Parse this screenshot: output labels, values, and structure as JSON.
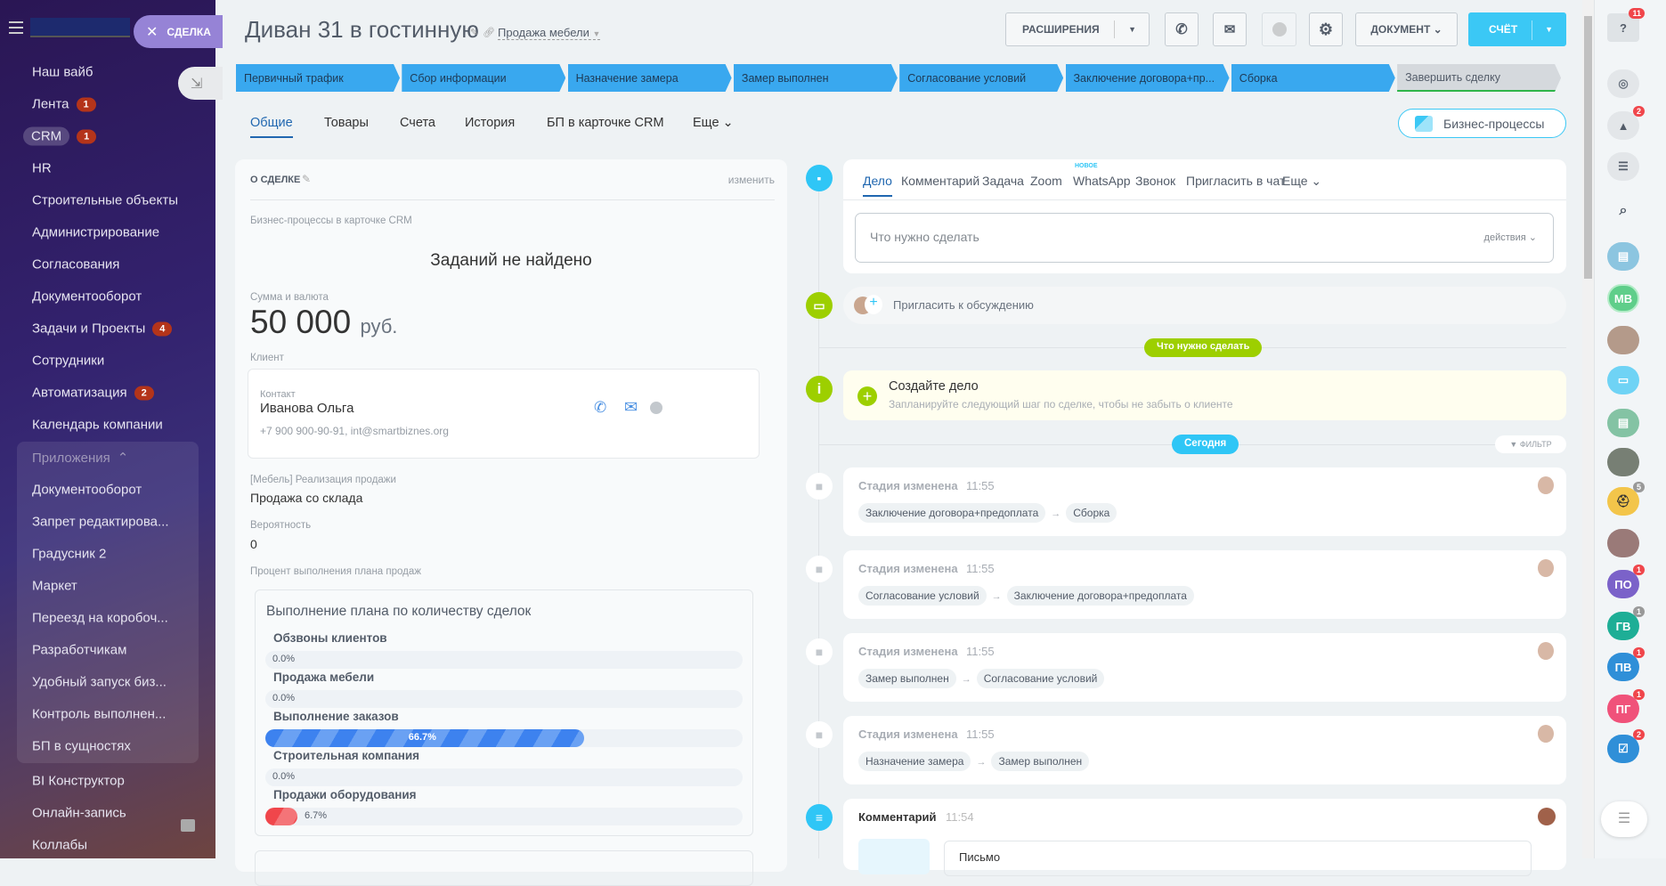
{
  "sidebar": {
    "deal_pill": "СДЕЛКА",
    "items": [
      {
        "label": "Наш вайб"
      },
      {
        "label": "Лента",
        "badge": "1"
      },
      {
        "label": "CRM",
        "badge": "1"
      },
      {
        "label": "HR"
      },
      {
        "label": "Строительные объекты"
      },
      {
        "label": "Администрирование"
      },
      {
        "label": "Согласования"
      },
      {
        "label": "Документооборот"
      },
      {
        "label": "Задачи и Проекты",
        "badge": "4"
      },
      {
        "label": "Сотрудники"
      },
      {
        "label": "Автоматизация",
        "badge": "2"
      },
      {
        "label": "Календарь компании"
      }
    ],
    "apps_header": "Приложения",
    "apps": [
      "Документооборот",
      "Запрет редактирова...",
      "Градусник 2",
      "Маркет",
      "Переезд на коробоч...",
      "Разработчикам",
      "Удобный запуск биз...",
      "Контроль выполнен...",
      "БП в сущностях"
    ],
    "bottom": [
      "BI Конструктор",
      "Онлайн-запись",
      "Коллабы"
    ]
  },
  "header": {
    "title": "Диван 31 в гостинную",
    "pipeline": "Продажа мебели",
    "extensions": "РАСШИРЕНИЯ",
    "document": "ДОКУМЕНТ",
    "invoice": "СЧЁТ"
  },
  "stages": [
    "Первичный трафик",
    "Сбор информации",
    "Назначение замера",
    "Замер выполнен",
    "Согласование условий",
    "Заключение договора+пр...",
    "Сборка",
    "Завершить сделку"
  ],
  "tabs": [
    "Общие",
    "Товары",
    "Счета",
    "История",
    "БП в карточке CRM",
    "Еще"
  ],
  "bp_button": "Бизнес-процессы",
  "deal": {
    "section_title": "О СДЕЛКЕ",
    "edit": "изменить",
    "bp_label": "Бизнес-процессы в карточке CRM",
    "bp_empty": "Заданий не найдено",
    "sum_label": "Сумма и валюта",
    "sum": "50 000",
    "currency": "руб.",
    "client_label": "Клиент",
    "contact_label": "Контакт",
    "contact_name": "Иванова Ольга",
    "contact_info": "+7 900 900-90-91, int@smartbiznes.org",
    "field1_label": "[Мебель] Реализация продажи",
    "field1_value": "Продажа со склада",
    "prob_label": "Вероятность",
    "prob_value": "0",
    "plan_label": "Процент выполнения плана продаж",
    "plan_title": "Выполнение плана по количеству сделок",
    "plans": [
      {
        "name": "Обзвоны клиентов",
        "percent": 0,
        "text": "0.0%"
      },
      {
        "name": "Продажа мебели",
        "percent": 0,
        "text": "0.0%"
      },
      {
        "name": "Выполнение заказов",
        "percent": 66.7,
        "text": "66.7%"
      },
      {
        "name": "Строительная компания",
        "percent": 0,
        "text": "0.0%"
      },
      {
        "name": "Продажи оборудования",
        "percent": 6.7,
        "text": "6.7%"
      }
    ]
  },
  "timeline": {
    "composer_tabs": [
      "Дело",
      "Комментарий",
      "Задача",
      "Zoom",
      "WhatsApp",
      "Звонок",
      "Пригласить в чат",
      "Еще"
    ],
    "new_badge": "НОВОЕ",
    "placeholder": "Что нужно сделать",
    "actions": "действия",
    "invite": "Пригласить к обсуждению",
    "todo_badge": "Что нужно сделать",
    "create_title": "Создайте дело",
    "create_sub": "Запланируйте следующий шаг по сделке, чтобы не забыть о клиенте",
    "today_badge": "Сегодня",
    "filter": "ФИЛЬТР",
    "events": [
      {
        "title": "Стадия изменена",
        "time": "11:55",
        "from": "Заключение договора+предоплата",
        "to": "Сборка"
      },
      {
        "title": "Стадия изменена",
        "time": "11:55",
        "from": "Согласование условий",
        "to": "Заключение договора+предоплата"
      },
      {
        "title": "Стадия изменена",
        "time": "11:55",
        "from": "Замер выполнен",
        "to": "Согласование условий"
      },
      {
        "title": "Стадия изменена",
        "time": "11:55",
        "from": "Назначение замера",
        "to": "Замер выполнен"
      }
    ],
    "comment_title": "Комментарий",
    "comment_time": "11:54",
    "comment_text": "Письмо"
  },
  "right_panel": {
    "help_badge": "11",
    "bell_badge": "2",
    "mb": "МВ",
    "chats": [
      {
        "t": "ПО",
        "b": "1",
        "c": "#7b62c9"
      },
      {
        "t": "ГВ",
        "b": "1",
        "c": "#1eae96"
      },
      {
        "t": "ПВ",
        "b": "1",
        "c": "#2f8fd8"
      },
      {
        "t": "ПГ",
        "b": "1",
        "c": "#f0527a"
      }
    ],
    "worker_badge": "5",
    "task_badge": "2"
  },
  "colors": {
    "stage": "#39a8ef",
    "accent": "#3bc8f5",
    "green": "#9dcf00"
  }
}
